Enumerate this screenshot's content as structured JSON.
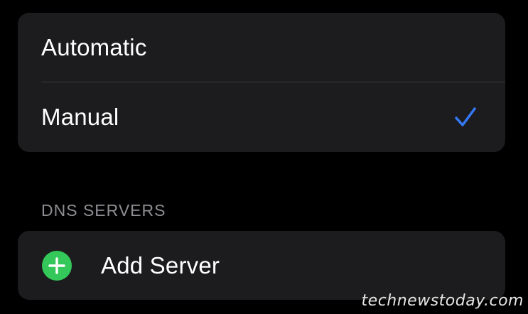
{
  "mode_group": {
    "options": [
      {
        "label": "Automatic",
        "selected": false
      },
      {
        "label": "Manual",
        "selected": true
      }
    ]
  },
  "dns_section": {
    "header": "DNS SERVERS",
    "add_label": "Add Server"
  },
  "icons": {
    "selected_indicator": "checkmark-icon",
    "add_indicator": "plus-circle-icon"
  },
  "colors": {
    "background": "#000000",
    "group_background": "#1c1c1e",
    "accent_blue": "#3478f6",
    "add_green": "#34c759",
    "section_header": "#8d8d93"
  },
  "watermark": "technewstoday.com"
}
